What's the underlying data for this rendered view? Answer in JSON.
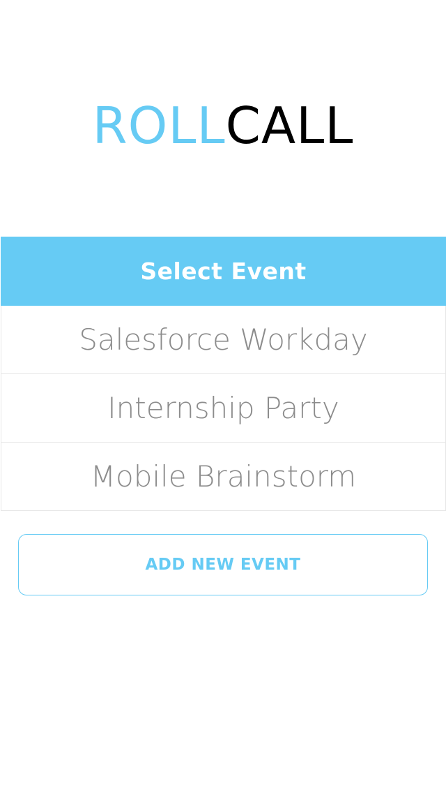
{
  "logo": {
    "part1": "ROLL",
    "part2": "CALL"
  },
  "colors": {
    "accent": "#66cbf4",
    "logo_dark": "#000000",
    "row_text": "#8c8c8c",
    "divider": "#e6e6e6"
  },
  "event_list": {
    "header": "Select Event",
    "events": [
      {
        "label": "Salesforce Workday"
      },
      {
        "label": "Internship Party"
      },
      {
        "label": "Mobile Brainstorm"
      }
    ]
  },
  "actions": {
    "add_new_event": "ADD NEW EVENT"
  }
}
